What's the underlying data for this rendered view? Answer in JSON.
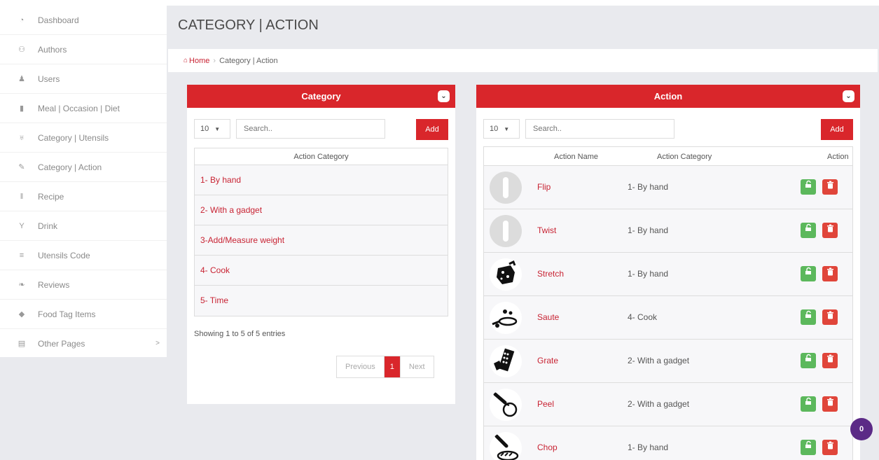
{
  "sidebar": {
    "items": [
      {
        "label": "Dashboard",
        "icon": "dashboard-icon",
        "glyph": "◔"
      },
      {
        "label": "Authors",
        "icon": "authors-icon",
        "glyph": "⚇"
      },
      {
        "label": "Users",
        "icon": "user-icon",
        "glyph": "♟"
      },
      {
        "label": "Meal | Occasion | Diet",
        "icon": "bookmark-icon",
        "glyph": "▮"
      },
      {
        "label": "Category | Utensils",
        "icon": "trophy-icon",
        "glyph": "♅"
      },
      {
        "label": "Category | Action",
        "icon": "edit-icon",
        "glyph": "✎"
      },
      {
        "label": "Recipe",
        "icon": "cutlery-icon",
        "glyph": "ǁ"
      },
      {
        "label": "Drink",
        "icon": "glass-icon",
        "glyph": "Y"
      },
      {
        "label": "Utensils Code",
        "icon": "barcode-icon",
        "glyph": "≡"
      },
      {
        "label": "Reviews",
        "icon": "comments-icon",
        "glyph": "❧"
      },
      {
        "label": "Food Tag Items",
        "icon": "tag-icon",
        "glyph": "◆"
      },
      {
        "label": "Other Pages",
        "icon": "list-icon",
        "glyph": "▤",
        "chevron": ">"
      }
    ]
  },
  "page": {
    "title": "CATEGORY | ACTION"
  },
  "breadcrumb": {
    "home": "Home",
    "current": "Category | Action"
  },
  "category_panel": {
    "title": "Category",
    "page_length": "10",
    "search_placeholder": "Search..",
    "add_label": "Add",
    "column_header": "Action Category",
    "rows": [
      "1- By hand",
      "2- With a gadget",
      "3-Add/Measure weight",
      "4- Cook",
      "5- Time"
    ],
    "info": "Showing 1 to 5 of 5 entries",
    "pager": {
      "prev": "Previous",
      "current": "1",
      "next": "Next"
    }
  },
  "action_panel": {
    "title": "Action",
    "page_length": "10",
    "search_placeholder": "Search..",
    "add_label": "Add",
    "headers": {
      "name": "Action Name",
      "category": "Action Category",
      "action": "Action"
    },
    "rows": [
      {
        "name": "Flip",
        "category": "1- By hand",
        "thumb": "placeholder"
      },
      {
        "name": "Twist",
        "category": "1- By hand",
        "thumb": "placeholder"
      },
      {
        "name": "Stretch",
        "category": "1- By hand",
        "thumb": "stretch-image"
      },
      {
        "name": "Saute",
        "category": "4- Cook",
        "thumb": "saute-image"
      },
      {
        "name": "Grate",
        "category": "2- With a gadget",
        "thumb": "grate-image"
      },
      {
        "name": "Peel",
        "category": "2- With a gadget",
        "thumb": "peel-image"
      },
      {
        "name": "Chop",
        "category": "1- By hand",
        "thumb": "chop-image"
      }
    ]
  },
  "notification": {
    "count": "0"
  },
  "colors": {
    "accent": "#d9262b",
    "edit": "#5cb85c",
    "delete": "#e0453a",
    "badge": "#5b2a86"
  }
}
